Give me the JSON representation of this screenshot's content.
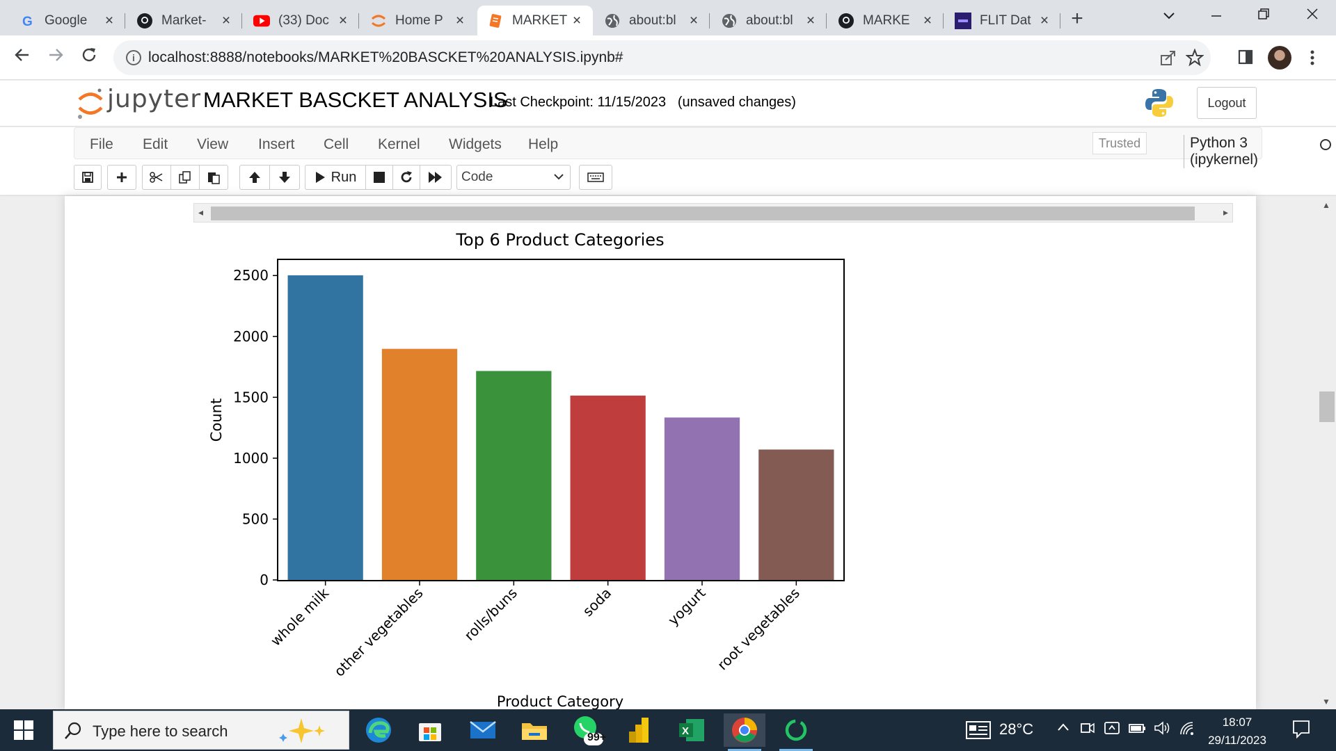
{
  "browser": {
    "tabs": [
      {
        "title": "Google",
        "icon": "google-icon"
      },
      {
        "title": "Market-",
        "icon": "github-icon"
      },
      {
        "title": "(33) Doc",
        "icon": "youtube-icon"
      },
      {
        "title": "Home P",
        "icon": "jupyter-icon"
      },
      {
        "title": "MARKET",
        "icon": "notebook-icon",
        "active": true
      },
      {
        "title": "about:bl",
        "icon": "globe-icon"
      },
      {
        "title": "about:bl",
        "icon": "globe-icon"
      },
      {
        "title": "MARKE",
        "icon": "github-icon"
      },
      {
        "title": "FLIT Dat",
        "icon": "site-icon"
      }
    ],
    "url": "localhost:8888/notebooks/MARKET%20BASCKET%20ANALYSIS.ipynb#"
  },
  "jupyter": {
    "logo_text": "jupyter",
    "notebook_name": "MARKET BASCKET ANALYSIS",
    "checkpoint": "Last Checkpoint: 11/15/2023   (unsaved changes)",
    "logout_label": "Logout",
    "menu": [
      "File",
      "Edit",
      "View",
      "Insert",
      "Cell",
      "Kernel",
      "Widgets",
      "Help"
    ],
    "trusted_label": "Trusted",
    "kernel_name": "Python 3 (ipykernel)",
    "toolbar": {
      "run_label": "Run",
      "cell_type": "Code"
    }
  },
  "chart_data": {
    "type": "bar",
    "title": "Top 6 Product Categories",
    "xlabel": "Product Category",
    "ylabel": "Count",
    "categories": [
      "whole milk",
      "other vegetables",
      "rolls/buns",
      "soda",
      "yogurt",
      "root vegetables"
    ],
    "values": [
      2502,
      1898,
      1716,
      1514,
      1334,
      1071
    ],
    "colors": [
      "#3274a1",
      "#e1812c",
      "#3a923a",
      "#c03d3e",
      "#9372b2",
      "#845b53"
    ],
    "yticks": [
      0,
      500,
      1000,
      1500,
      2000,
      2500
    ],
    "ylim": [
      0,
      2627
    ],
    "grid": false
  },
  "taskbar": {
    "search_placeholder": "Type here to search",
    "whatsapp_badge": "99+",
    "weather": "28°C",
    "time": "18:07",
    "date": "29/11/2023"
  }
}
